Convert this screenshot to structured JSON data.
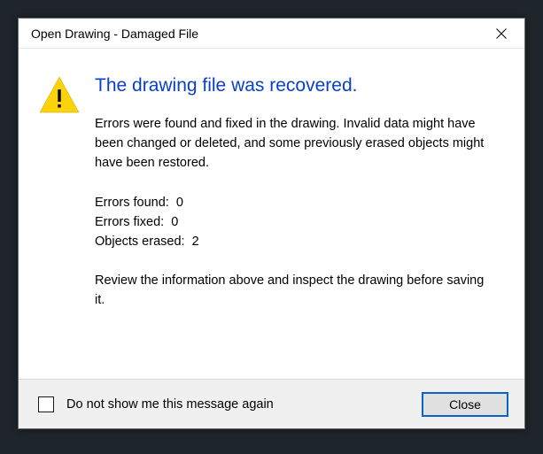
{
  "dialog": {
    "title": "Open Drawing - Damaged File",
    "heading": "The drawing file was recovered.",
    "description": "Errors were found and fixed in the drawing. Invalid data might have been changed or deleted, and some previously erased objects might have been restored.",
    "stats": {
      "errors_found_label": "Errors found:",
      "errors_found_value": "0",
      "errors_fixed_label": "Errors fixed:",
      "errors_fixed_value": "0",
      "objects_erased_label": "Objects erased:",
      "objects_erased_value": "2"
    },
    "advice": "Review the information above and inspect the drawing before saving it.",
    "checkbox_label": "Do not show me this message again",
    "close_button": "Close"
  }
}
